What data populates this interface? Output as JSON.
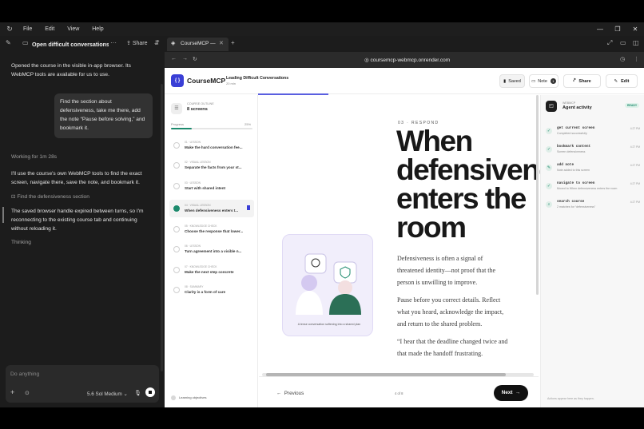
{
  "menubar": {
    "items": [
      "File",
      "Edit",
      "View",
      "Help"
    ]
  },
  "tabbar": {
    "thread_title": "Open difficult conversations de",
    "share": "Share",
    "browser_tab": "CourseMCP —"
  },
  "chat": {
    "intro": "Opened the course in the visible in-app browser. Its WebMCP tools are available for us to use.",
    "user_lines": [
      "Find the section about",
      "defensiveness, take me there, add",
      "the note “Pause before solving,” and",
      "bookmark it."
    ],
    "working": "Working for 1m 28s",
    "plan": "I'll use the course's own WebMCP tools to find the exact screen, navigate there, save the note, and bookmark it.",
    "step": "Find the defensiveness section",
    "status": "The saved browser handle expired between turns, so I'm reconnecting to the existing course tab and continuing without reloading it.",
    "thinking": "Thinking",
    "composer_placeholder": "Do anything",
    "model": "5.6 Sol  Medium"
  },
  "browser": {
    "url": "coursemcp-webmcp.onrender.com"
  },
  "page": {
    "brand": "CourseMCP",
    "logo": "{ }",
    "lesson_title": "Leading Difficult Conversations",
    "lesson_sub": "20 min",
    "saved": "Saved",
    "note": "Note",
    "note_count": "1",
    "share": "Share",
    "edit": "Edit",
    "outline": {
      "kicker": "COURSE OUTLINE",
      "count": "8 screens",
      "progress_label": "Progress",
      "progress_pct": "25%",
      "progress_value": 0.25,
      "items": [
        {
          "kicker": "01 · LESSON",
          "title": "Make the hard conversation fee..."
        },
        {
          "kicker": "02 · VISUAL LESSON",
          "title": "Separate the facts from your st..."
        },
        {
          "kicker": "03 · LESSON",
          "title": "Start with shared intent"
        },
        {
          "kicker": "04 · VISUAL LESSON",
          "title": "When defensiveness enters t..."
        },
        {
          "kicker": "05 · KNOWLEDGE CHECK",
          "title": "Choose the response that lower..."
        },
        {
          "kicker": "06 · LESSON",
          "title": "Turn agreement into a visible n..."
        },
        {
          "kicker": "07 · KNOWLEDGE CHECK",
          "title": "Make the next step concrete"
        },
        {
          "kicker": "08 · SUMMARY",
          "title": "Clarity is a form of care"
        }
      ],
      "footer": "Learning objectives"
    },
    "main": {
      "label": "03 · RESPOND",
      "heading": "When defensiveness enters the room",
      "paragraphs": [
        "Defensiveness is often a signal of threatened identity—not proof that the person is unwilling to improve.",
        "Pause before you correct details. Reflect what you heard, acknowledge the impact, and return to the shared problem.",
        "“I hear that the deadline changed twice and that made the handoff frustrating."
      ],
      "illus_caption": "A tense conversation softening into a shared plan",
      "prev": "Previous",
      "pager": "4 of 8",
      "next": "Next"
    },
    "activity": {
      "kicker": "WEBMCP",
      "title": "Agent activity",
      "ready": "READY",
      "items": [
        {
          "name": "get current screen",
          "desc": "Completed successfully",
          "time": "4:27 PM"
        },
        {
          "name": "bookmark content",
          "desc": "Screen defensiveness",
          "time": "4:27 PM"
        },
        {
          "name": "add note",
          "desc": "Note added to this screen",
          "time": "4:27 PM"
        },
        {
          "name": "navigate to screen",
          "desc": "Moved to When defensiveness enters the room",
          "time": "4:27 PM"
        },
        {
          "name": "search course",
          "desc": "2 matches for “defensiveness”",
          "time": "4:27 PM"
        }
      ],
      "footer": "Actions appear here as they happen."
    }
  },
  "colors": {
    "accent": "#3a3fd6",
    "success": "#1d8a6d"
  }
}
